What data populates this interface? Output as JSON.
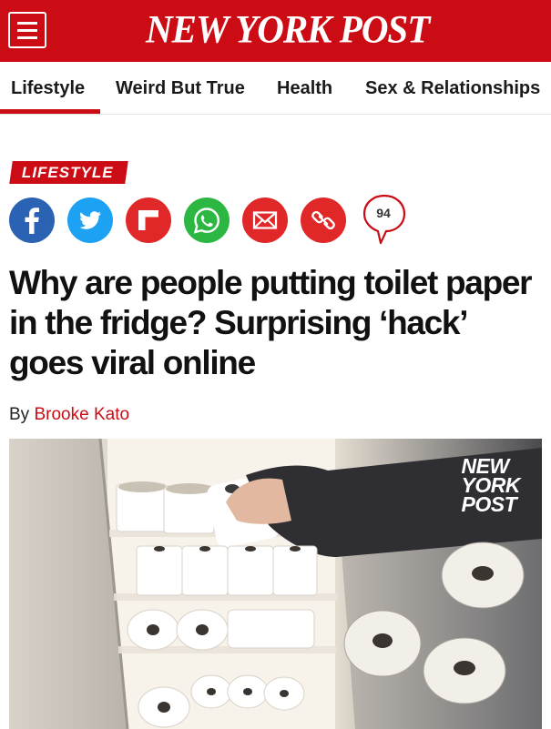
{
  "header": {
    "logo_text": "NEW YORK POST",
    "menu_icon": "hamburger-menu-icon",
    "brand_color": "#cc0c14"
  },
  "nav": {
    "items": [
      {
        "label": "Lifestyle",
        "active": true
      },
      {
        "label": "Weird But True"
      },
      {
        "label": "Health"
      },
      {
        "label": "Sex & Relationships"
      }
    ]
  },
  "article": {
    "section": "LIFESTYLE",
    "share": {
      "icons": [
        "facebook-icon",
        "twitter-icon",
        "flipboard-icon",
        "whatsapp-icon",
        "email-icon",
        "copy-link-icon"
      ],
      "comment_count": "94"
    },
    "headline": "Why are people putting toilet paper in the fridge? Surprising ‘hack’ goes viral online",
    "byline_prefix": "By",
    "author": "Brooke Kato",
    "photo": {
      "watermark": [
        "NEW",
        "YORK",
        "POST"
      ]
    }
  }
}
